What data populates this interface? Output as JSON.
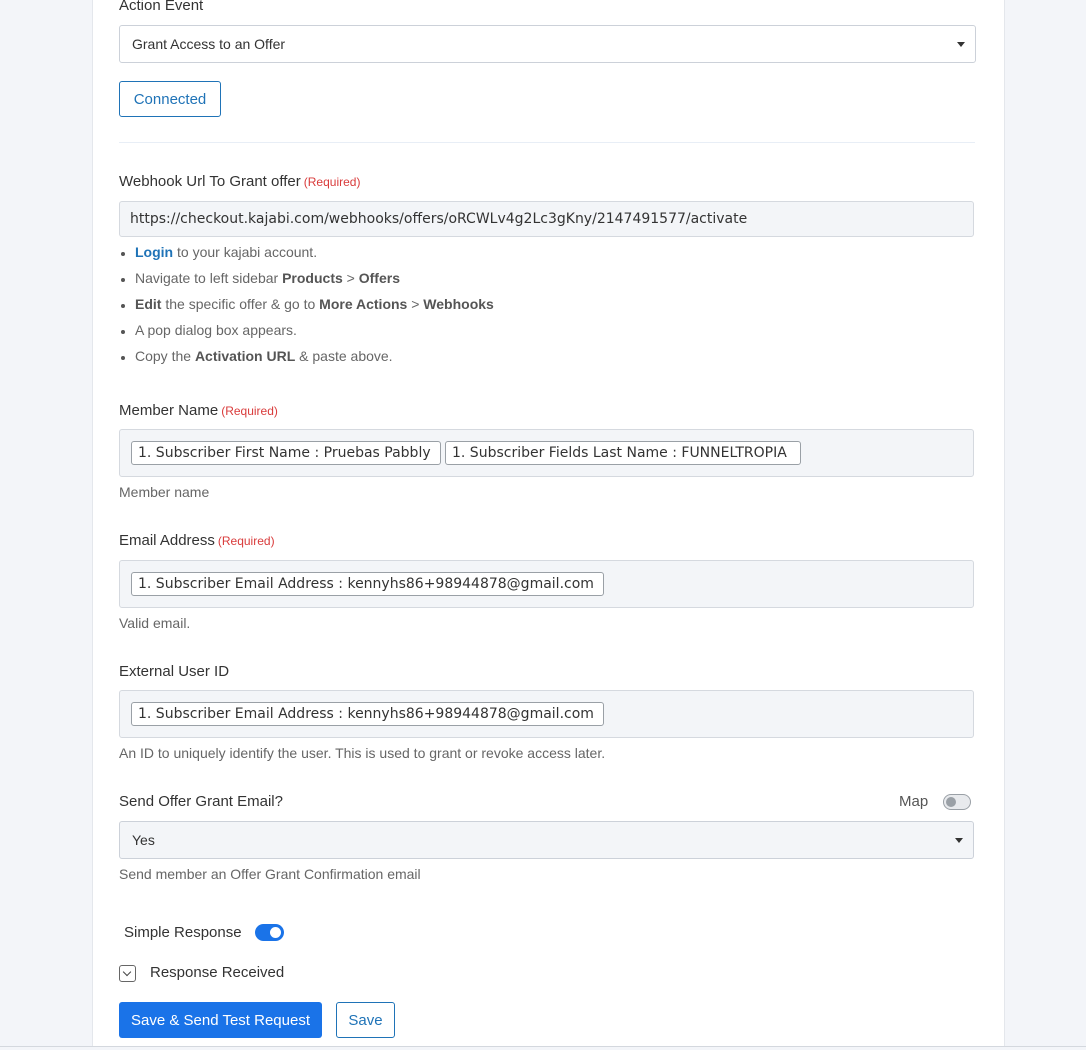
{
  "action_event": {
    "label": "Action Event",
    "selected": "Grant Access to an Offer"
  },
  "connection": {
    "status_label": "Connected"
  },
  "webhook": {
    "label": "Webhook Url To Grant offer",
    "required": "(Required)",
    "value": "https://checkout.kajabi.com/webhooks/offers/oRCWLv4g2Lc3gKny/2147491577/activate",
    "steps": [
      {
        "parts": [
          {
            "t": "Login",
            "s": "link"
          },
          {
            "t": " to your kajabi account.",
            "s": "plain"
          }
        ]
      },
      {
        "parts": [
          {
            "t": "Navigate to left sidebar ",
            "s": "plain"
          },
          {
            "t": "Products",
            "s": "bold"
          },
          {
            "t": " > ",
            "s": "plain"
          },
          {
            "t": "Offers",
            "s": "bold"
          }
        ]
      },
      {
        "parts": [
          {
            "t": "Edit",
            "s": "bold"
          },
          {
            "t": " the specific offer & go to ",
            "s": "plain"
          },
          {
            "t": "More Actions",
            "s": "bold"
          },
          {
            "t": " > ",
            "s": "plain"
          },
          {
            "t": "Webhooks",
            "s": "bold"
          }
        ]
      },
      {
        "parts": [
          {
            "t": "A pop dialog box appears.",
            "s": "plain"
          }
        ]
      },
      {
        "parts": [
          {
            "t": "Copy the ",
            "s": "plain"
          },
          {
            "t": "Activation URL",
            "s": "bold"
          },
          {
            "t": " & paste above.",
            "s": "plain"
          }
        ]
      }
    ]
  },
  "member_name": {
    "label": "Member Name",
    "required": "(Required)",
    "tags": [
      "1. Subscriber First Name : Pruebas Pabbly",
      "1. Subscriber Fields Last Name : FUNNELTROPIA"
    ],
    "help": "Member name"
  },
  "email": {
    "label": "Email Address",
    "required": "(Required)",
    "tag": "1. Subscriber Email Address : kennyhs86+98944878@gmail.com",
    "help": "Valid email."
  },
  "external_id": {
    "label": "External User ID",
    "tag": "1. Subscriber Email Address : kennyhs86+98944878@gmail.com",
    "help": "An ID to uniquely identify the user. This is used to grant or revoke access later."
  },
  "grant_email": {
    "label": "Send Offer Grant Email?",
    "map_label": "Map",
    "map_enabled": false,
    "selected": "Yes",
    "help": "Send member an Offer Grant Confirmation email"
  },
  "simple_response": {
    "label": "Simple Response",
    "enabled": true
  },
  "response_received": {
    "label": "Response Received"
  },
  "buttons": {
    "save_send": "Save & Send Test Request",
    "save": "Save"
  },
  "colors": {
    "accent": "#1a73e8",
    "required": "#d93b3b"
  }
}
